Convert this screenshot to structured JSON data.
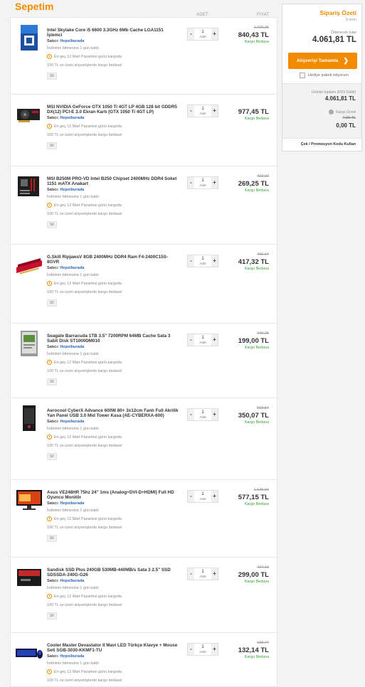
{
  "cart": {
    "title": "Sepetim",
    "col_qty": "ADET",
    "col_price": "FIYAT",
    "seller_label": "Satıcı:",
    "stock_text": "İndirimin bitmesine 1 gün kaldı",
    "shipping_text": "En geç 12 Mart Pazartesi günü kargoda",
    "free_text": "100 TL ve üzeri alışverişlerde kargo bedava!",
    "delete_label": "Sil",
    "qty_unit": "Adet",
    "free_shipping_label": "Kargo Bedava",
    "items": [
      {
        "name": "Intel Skylake Core i5 6600 3.3GHz 6Mb Cache LGA1151 İşlemci",
        "seller": "Hepsiburada",
        "qty": "1",
        "old_price": "1.229,25",
        "price": "840,43 TL",
        "icon": "cpu-box-icon",
        "has_stock": true
      },
      {
        "name": "MSI NVIDIA GeForce GTX 1050 Ti 4GT LP 4GB 128 bit GDDR5 DX(12) PCI-E 3.0 Ekran Kartı (GTX 1050 Ti 4GT LP)",
        "seller": "Hepsiburada",
        "qty": "1",
        "old_price": "",
        "price": "977,45 TL",
        "icon": "graphics-card-icon",
        "has_stock": false
      },
      {
        "name": "MSI B250M PRO-VD Intel B250 Chipset 2400MHz DDR4 Soket 1151 mATX Anakart",
        "seller": "Hepsiburada",
        "qty": "1",
        "old_price": "423,02",
        "price": "269,25 TL",
        "icon": "motherboard-icon",
        "has_stock": true
      },
      {
        "name": "G.Skill RipjawsV 8GB 2400MHz DDR4 Ram F4-2400C15S-8GVR",
        "seller": "Hepsiburada",
        "qty": "1",
        "old_price": "490,94",
        "price": "417,32 TL",
        "icon": "ram-stick-icon",
        "has_stock": true
      },
      {
        "name": "Seagate Barracuda 1TB 3.5\" 7200RPM 64MB Cache Sata 3 Sabit Disk ST1000DM010",
        "seller": "Hepsiburada",
        "qty": "1",
        "old_price": "249,25",
        "price": "199,00 TL",
        "icon": "hard-disk-icon",
        "has_stock": true
      },
      {
        "name": "Aerocool CyberX Advance 600W 80+ 3x12cm Fanlı Full Akrilik Yan Panel USB 3.0 Mid Tower Kasa (AE-CYBERXA-600)",
        "seller": "Hepsiburada",
        "qty": "1",
        "old_price": "503,54",
        "price": "350,07 TL",
        "icon": "pc-case-icon",
        "has_stock": true
      },
      {
        "name": "Asus VE248HR 75hz 24\" 1ms (Analog+DVI-D+HDMI) Full HD Oyuncu Monitör",
        "seller": "Hepsiburada",
        "qty": "1",
        "old_price": "1.125,93",
        "price": "577,15 TL",
        "icon": "monitor-icon",
        "has_stock": true
      },
      {
        "name": "Sandisk SSD Plus 240GB 530MB-440MB/s Sata 3 2.5\" SSD SDSSDA-240G-G26",
        "seller": "Hepsiburada",
        "qty": "1",
        "old_price": "424,13",
        "price": "299,00 TL",
        "icon": "ssd-icon",
        "has_stock": true
      },
      {
        "name": "Cooler Master Devastator II Mavi LED Türkçe Klavye + Mouse Seti SGB-3030-KKMF1-TU",
        "seller": "Hepsiburada",
        "qty": "1",
        "old_price": "188,74",
        "price": "132,14 TL",
        "icon": "keyboard-mouse-icon",
        "has_stock": true
      }
    ]
  },
  "summary": {
    "title": "Sipariş Özeti",
    "count": "9 ürün",
    "pay_label": "Ödenecek tutar",
    "total": "4.061,81 TL",
    "button_label": "Alışverişi Tamamla",
    "gift_label": "Hediye paketi istiyorum",
    "products_label": "Ürünler toplamı (KDV Dahil)",
    "products_total": "4.061,81 TL",
    "shipping_label": "Kargo Ücreti",
    "shipping_old": "7,90 TL",
    "shipping_new": "0,00 TL",
    "promo_label": "Çek / Promosyon Kodu Kullan"
  },
  "colors": {
    "accent": "#f28b00",
    "seller": "#2a66b8",
    "free": "#3a9f3a"
  }
}
